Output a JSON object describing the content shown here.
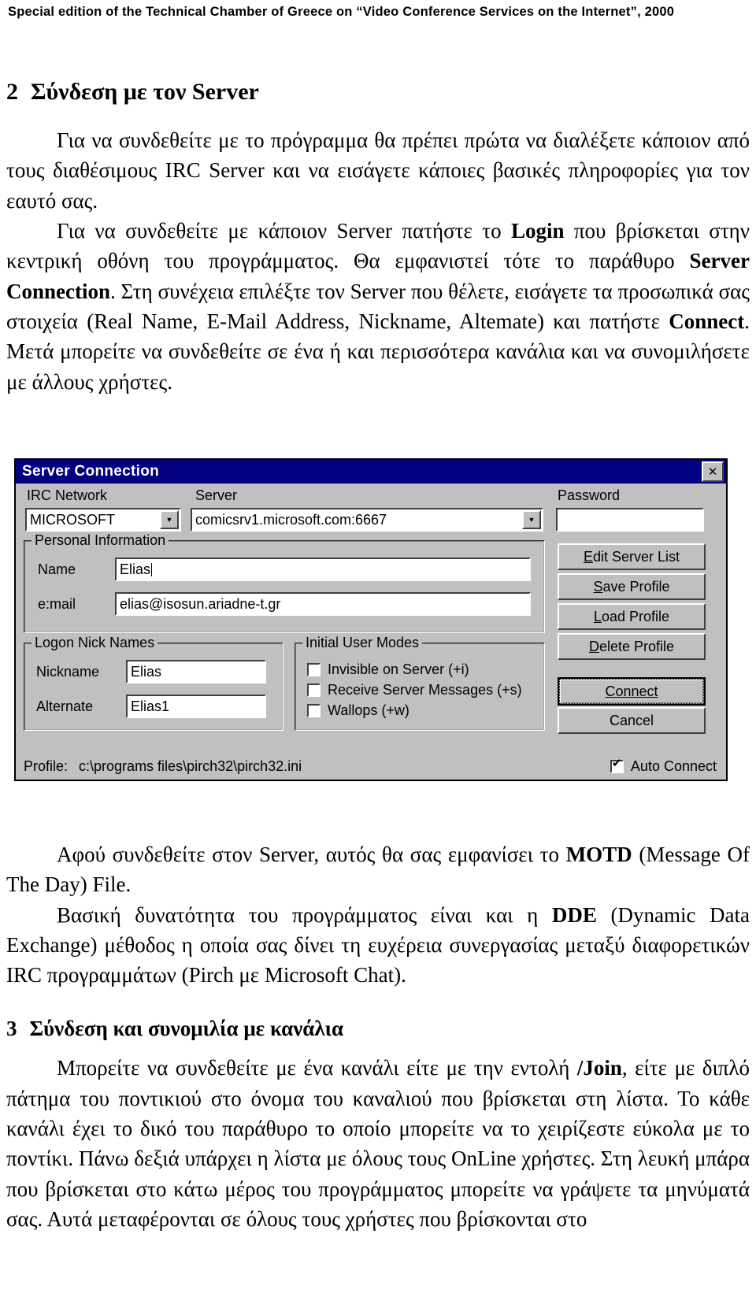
{
  "running_header": "Special edition of the Technical Chamber of Greece on “Video Conference Services on the Internet”, 2000",
  "sections": [
    {
      "number": "2",
      "title": "Σύνδεση με τον Server",
      "paragraphs": [
        "Για να συνδεθείτε με το πρόγραμμα θα πρέπει πρώτα να διαλέξετε κάποιον από τους διαθέσιμους IRC Server και να εισάγετε κάποιες βασικές πληροφορίες για τον εαυτό σας.",
        "Για να συνδεθείτε με κάποιον Server πατήστε το Login που βρίσκεται στην κεντρική οθόνη του προγράμματος. Θα εμφανιστεί τότε το παράθυρο Server Connection. Στη συνέχεια επιλέξτε τον Server που θέλετε, εισάγετε τα προσωπικά σας στοιχεία (Real Name, E-Mail Address, Nickname, Altemate) και πατήστε Connect. Μετά μπορείτε να συνδεθείτε σε ένα ή και περισσότερα κανάλια και να συνομιλήσετε με άλλους χρήστες."
      ]
    }
  ],
  "after_figure_paragraphs": [
    "Αφού συνδεθείτε στον Server, αυτός θα σας εμφανίσει το MOTD (Message Of The Day) File.",
    "Βασική δυνατότητα του προγράμματος είναι και η DDE (Dynamic Data Exchange) μέθοδος η οποία σας δίνει τη ευχέρεια συνεργασίας μεταξύ διαφορετικών IRC προγραμμάτων (Pirch με Microsoft Chat)."
  ],
  "section3": {
    "number": "3",
    "title": "Σύνδεση και συνομιλία με κανάλια",
    "paragraphs": [
      "Μπορείτε να συνδεθείτε με ένα κανάλι είτε με την εντολή /Join, είτε με διπλό πάτημα του ποντικιού στο όνομα του καναλιού που βρίσκεται στη λίστα. Το κάθε κανάλι έχει το δικό του παράθυρο το οποίο μπορείτε να το χειρίζεστε εύκολα με το ποντίκι. Πάνω δεξιά υπάρχει η λίστα με όλους τους OnLine χρήστες. Στη λευκή μπάρα που βρίσκεται στο κάτω μέρος του προγράμματος μπορείτε να γράψετε τα μηνύματά σας. Αυτά μεταφέρονται σε όλους τους χρήστες που βρίσκονται στο"
    ]
  },
  "dialog": {
    "title": "Server Connection",
    "close_label": "✕",
    "labels": {
      "irc_network": "IRC Network",
      "server": "Server",
      "password": "Password",
      "personal_information": "Personal Information",
      "name": "Name",
      "email": "e:mail",
      "logon_nick_names": "Logon Nick Names",
      "nickname": "Nickname",
      "alternate": "Alternate",
      "initial_user_modes": "Initial User Modes",
      "profile": "Profile:"
    },
    "values": {
      "irc_network": "MICROSOFT",
      "server": "comicsrv1.microsoft.com:6667",
      "password": "",
      "name": "Elias",
      "email": "elias@isosun.ariadne-t.gr",
      "nickname": "Elias",
      "alternate": "Elias1",
      "profile_path": "c:\\programs files\\pirch32\\pirch32.ini"
    },
    "checkboxes": [
      {
        "label": "Invisible on Server (+i)",
        "checked": false
      },
      {
        "label": "Receive Server Messages (+s)",
        "checked": false
      },
      {
        "label": "Wallops (+w)",
        "checked": false
      }
    ],
    "auto_connect": {
      "label": "Auto Connect",
      "checked": true
    },
    "buttons": [
      {
        "mnemonic": "E",
        "rest": "dit Server List",
        "default": false
      },
      {
        "mnemonic": "S",
        "rest": "ave Profile",
        "default": false
      },
      {
        "mnemonic": "L",
        "rest": "oad Profile",
        "default": false
      },
      {
        "mnemonic": "D",
        "rest": "elete Profile",
        "default": false
      }
    ],
    "connect_button": {
      "label": "Connect",
      "default": true
    },
    "cancel_button": {
      "label": "Cancel",
      "default": false
    },
    "colors": {
      "titlebar": "#000080",
      "face": "#c0c0c0",
      "field": "#ffffff",
      "shadow": "#404040"
    }
  }
}
